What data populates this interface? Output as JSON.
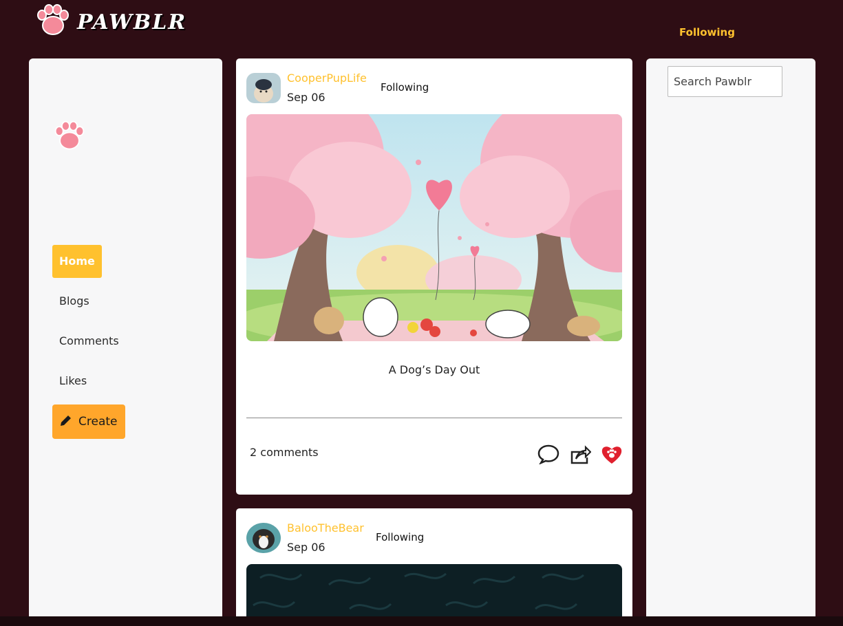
{
  "header": {
    "logo_text": "PAWBLR",
    "following_link": "Following"
  },
  "sidebar": {
    "items": [
      {
        "label": "Home",
        "active": true
      },
      {
        "label": "Blogs"
      },
      {
        "label": "Comments"
      },
      {
        "label": "Likes"
      }
    ],
    "create_label": "Create"
  },
  "search": {
    "placeholder": "Search Pawblr"
  },
  "posts": [
    {
      "username": "CooperPupLife",
      "date": "Sep 06",
      "follow_status": "Following",
      "title": "A Dog’s Day Out",
      "comments": "2 comments"
    },
    {
      "username": "BalooTheBear",
      "date": "Sep 06",
      "follow_status": "Following"
    }
  ],
  "colors": {
    "background": "#2e0d14",
    "accent": "#ffc12e",
    "create": "#ffa62b",
    "like": "#e0202e"
  }
}
